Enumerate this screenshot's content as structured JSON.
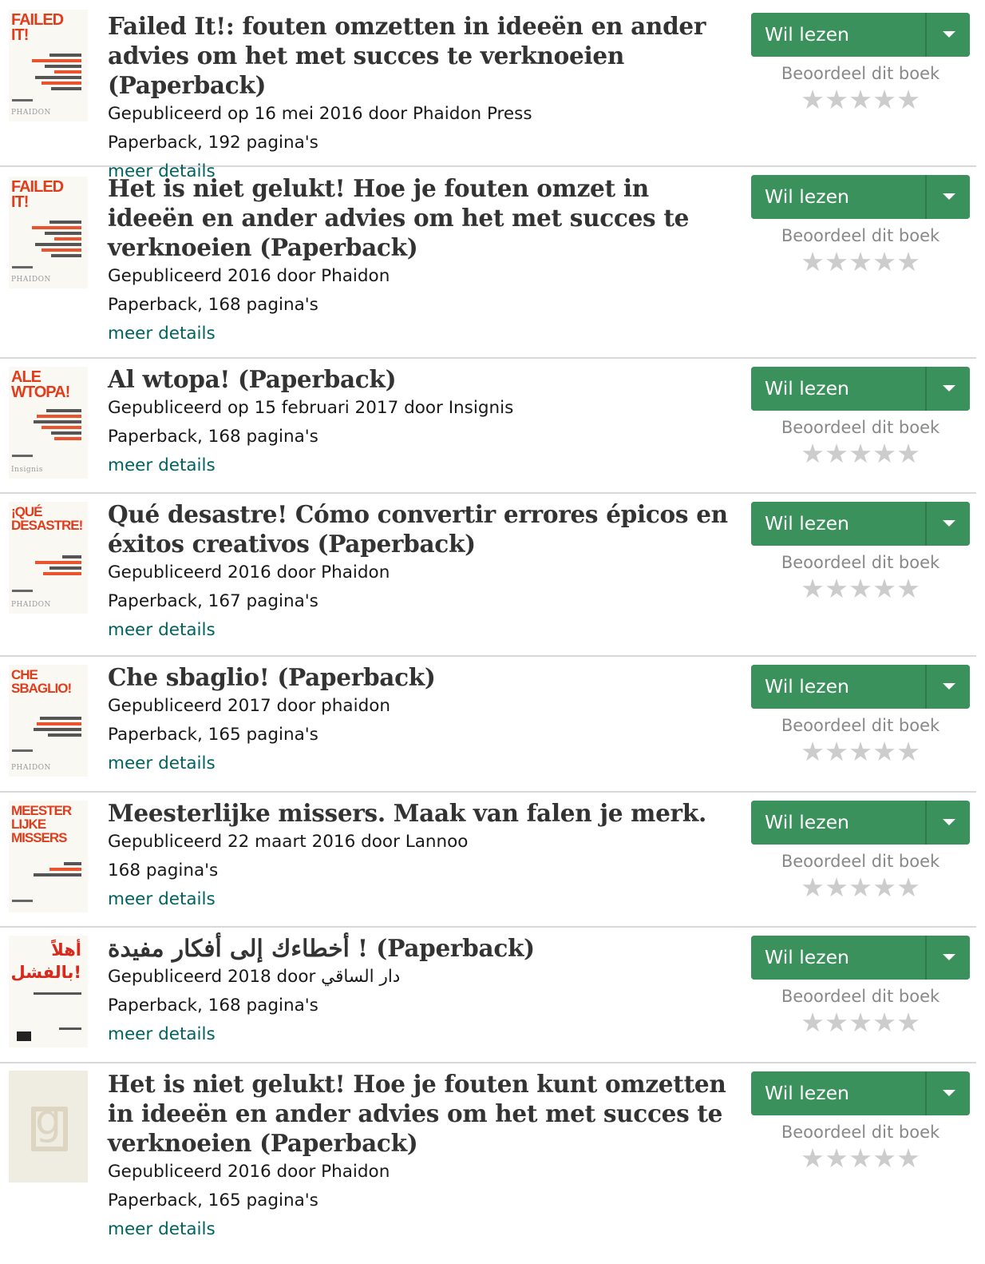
{
  "actions": {
    "want_to_read": "Wil lezen",
    "rate_label": "Beoordeel dit boek",
    "details_link": "meer details",
    "star": "★"
  },
  "editions": [
    {
      "cover_text": "FAILED\nIT!",
      "title": "Failed It!: fouten omzetten in ideeën en ander advies om het met succes te verknoeien (Paperback)",
      "published": "Gepubliceerd op 16 mei 2016 door Phaidon Press",
      "format": "Paperback, 192 pagina's",
      "cover_publisher": "PHAIDON"
    },
    {
      "cover_text": "FAILED\nIT!",
      "title": "Het is niet gelukt! Hoe je fouten omzet in ideeën en ander advies om het met succes te verknoeien (Paperback)",
      "published": "Gepubliceerd 2016 door Phaidon",
      "format": "Paperback, 168 pagina's",
      "cover_publisher": "PHAIDON"
    },
    {
      "cover_text": "ALE\nWTOPA!",
      "title": "Al wtopa! (Paperback)",
      "published": "Gepubliceerd op 15 februari 2017 door Insignis",
      "format": "Paperback, 168 pagina's",
      "cover_publisher": "Insignis"
    },
    {
      "cover_text": "¡QUÉ\nDESASTRE!",
      "title": "Qué desastre! Cómo convertir errores épicos en éxitos creativos (Paperback)",
      "published": "Gepubliceerd 2016 door Phaidon",
      "format": "Paperback, 167 pagina's",
      "cover_publisher": "PHAIDON"
    },
    {
      "cover_text": "CHE\nSBAGLIO!",
      "title": "Che sbaglio! (Paperback)",
      "published": "Gepubliceerd 2017 door phaidon",
      "format": "Paperback, 165 pagina's",
      "cover_publisher": "PHAIDON"
    },
    {
      "cover_text": "MEESTER\nLIJKE\nMISSERS",
      "title": "Meesterlijke missers. Maak van falen je merk.",
      "published": "Gepubliceerd 22 maart 2016 door Lannoo",
      "format": "168 pagina's",
      "cover_publisher": ""
    },
    {
      "cover_text": "أهلاً\nبالفشل!",
      "title": "أخطاءك إلى أفكار مفيدة ! (Paperback)",
      "published": "Gepubliceerd 2018 door دار الساقي",
      "format": "Paperback, 168 pagina's",
      "cover_publisher": ""
    },
    {
      "cover_text": "g",
      "title": "Het is niet gelukt! Hoe je fouten kunt omzetten in ideeën en ander advies om het met succes te verknoeien (Paperback)",
      "published": "Gepubliceerd 2016 door Phaidon",
      "format": "Paperback, 165 pagina's",
      "cover_publisher": ""
    }
  ],
  "colors": {
    "button_green": "#3a915b",
    "link_green": "#00635d",
    "cover_orange": "#e03d1d",
    "star_grey": "#cccccc"
  }
}
